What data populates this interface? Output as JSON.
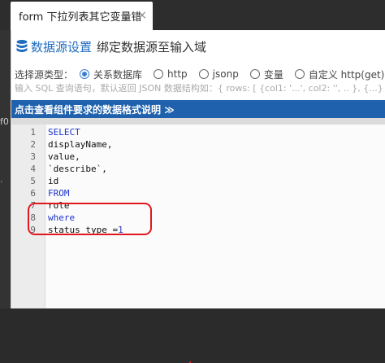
{
  "tab": {
    "title": "form 下拉列表其它变量错",
    "close": "×"
  },
  "left_edge": {
    "glyph1": "f0",
    "glyph2": "·"
  },
  "dialog": {
    "title": "数据源设置",
    "subtitle": "绑定数据源至输入域",
    "source_type_label": "选择源类型：",
    "source_options": [
      {
        "label": "关系数据库",
        "selected": true
      },
      {
        "label": "http",
        "selected": false
      },
      {
        "label": "jsonp",
        "selected": false
      },
      {
        "label": "变量",
        "selected": false
      },
      {
        "label": "自定义 http(get) 接",
        "selected": false
      }
    ],
    "hint": "输入 SQL 查询语句，默认返回 JSON 数据结构如：{ rows: [ {col1: '...', col2: '', .. }, {...}, ...] }",
    "format_bar": "点击查看组件要求的数据格式说明 ≫"
  },
  "editor": {
    "lines": [
      {
        "n": "1",
        "text": "SELECT",
        "kw": true
      },
      {
        "n": "2",
        "text": "displayName,",
        "kw": false
      },
      {
        "n": "3",
        "text": "value,",
        "kw": false
      },
      {
        "n": "4",
        "text": "`describe`,",
        "kw": false
      },
      {
        "n": "5",
        "text": "id",
        "kw": false
      },
      {
        "n": "6",
        "text": "FROM",
        "kw": true
      },
      {
        "n": "7",
        "text": "role",
        "kw": false
      },
      {
        "n": "8",
        "text": "where",
        "kw": true
      },
      {
        "n": "9",
        "text": "status_type =",
        "kw": false,
        "num": "1"
      }
    ]
  },
  "colors": {
    "accent": "#1f61ad",
    "title_blue": "#1f6cc0",
    "highlight": "#e0181f",
    "keyword": "#1d35c9"
  }
}
